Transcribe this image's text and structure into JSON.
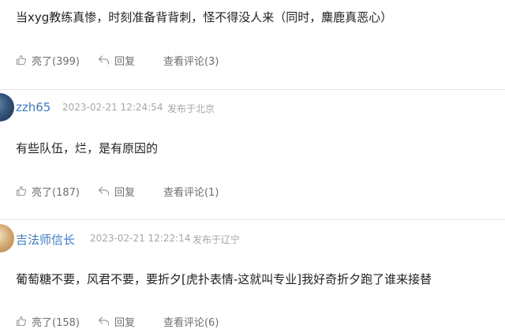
{
  "comments": [
    {
      "text": "当xyg教练真惨，时刻准备背背刺，怪不得没人来（同时，麋鹿真恶心）",
      "like_label": "亮了(399)",
      "reply_label": "回复",
      "view_label": "查看评论(3)"
    },
    {
      "username": "zzh65",
      "time": "2023-02-21 12:24:54",
      "location": "发布于北京",
      "text": "有些队伍，烂，是有原因的",
      "like_label": "亮了(187)",
      "reply_label": "回复",
      "view_label": "查看评论(1)"
    },
    {
      "username": "吉法师信长",
      "time": "2023-02-21 12:22:14",
      "location": "发布于辽宁",
      "text": "葡萄糖不要，风君不要，要折夕[虎扑表情-这就叫专业]我好奇折夕跑了谁来接替",
      "like_label": "亮了(158)",
      "reply_label": "回复",
      "view_label": "查看评论(6)"
    }
  ],
  "colors": {
    "username": "#3b7bbf",
    "meta": "#a6a6a6",
    "action": "#6e6e6e",
    "divider": "#e6e6e6"
  },
  "icons": {
    "like": "thumb-up-icon",
    "reply": "reply-arrow-icon"
  }
}
